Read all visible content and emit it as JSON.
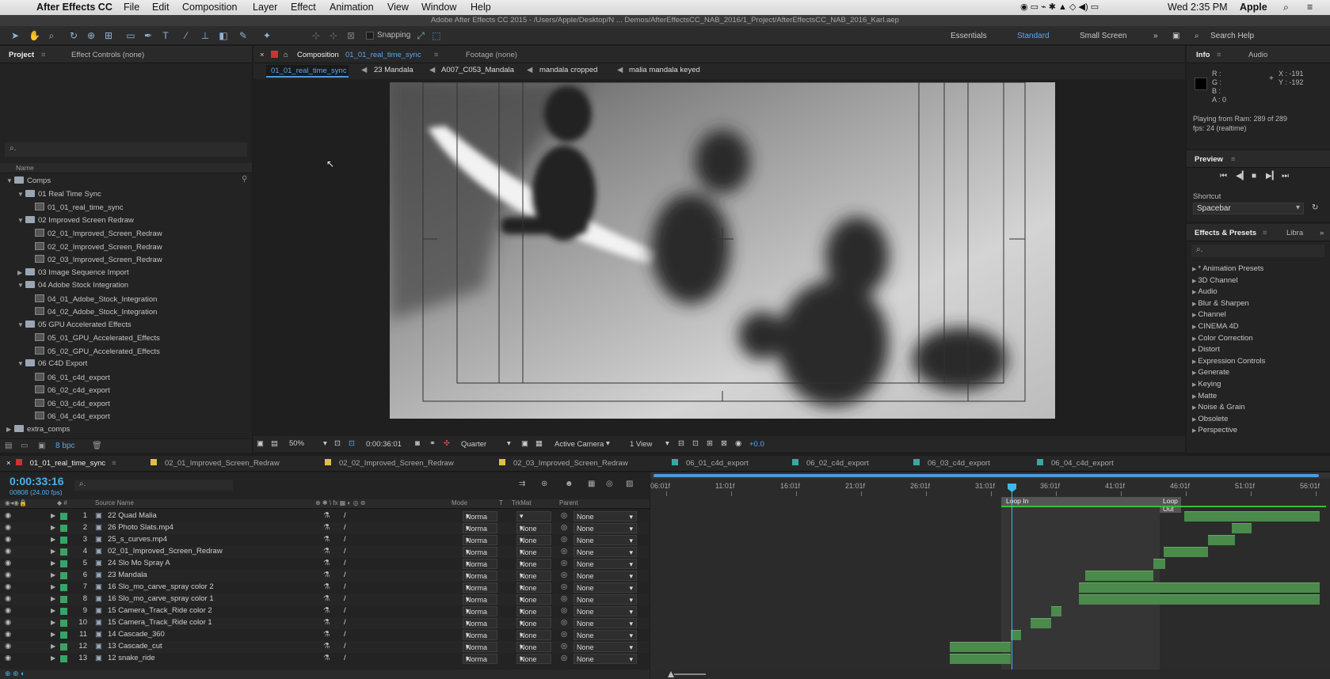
{
  "menubar": {
    "app": "After Effects CC",
    "menus": [
      "File",
      "Edit",
      "Composition",
      "Layer",
      "Effect",
      "Animation",
      "View",
      "Window",
      "Help"
    ],
    "clock": "Wed 2:35 PM",
    "user": "Apple"
  },
  "window_title": "Adobe After Effects CC 2015 - /Users/Apple/Desktop/N ... Demos/AfterEffectsCC_NAB_2016/1_Project/AfterEffectsCC_NAB_2016_Karl.aep",
  "toolbar": {
    "snapping": "Snapping",
    "workspaces": [
      "Essentials",
      "Standard",
      "Small Screen"
    ],
    "search_help": "Search Help"
  },
  "project": {
    "tab": "Project",
    "tab2": "Effect Controls (none)",
    "name_header": "Name",
    "bpc": "8 bpc",
    "tree": [
      {
        "level": 0,
        "type": "folder",
        "open": true,
        "label": "Comps"
      },
      {
        "level": 1,
        "type": "folder",
        "open": true,
        "label": "01 Real Time Sync"
      },
      {
        "level": 2,
        "type": "comp",
        "label": "01_01_real_time_sync"
      },
      {
        "level": 1,
        "type": "folder",
        "open": true,
        "label": "02 Improved Screen Redraw"
      },
      {
        "level": 2,
        "type": "comp",
        "label": "02_01_Improved_Screen_Redraw"
      },
      {
        "level": 2,
        "type": "comp",
        "label": "02_02_Improved_Screen_Redraw"
      },
      {
        "level": 2,
        "type": "comp",
        "label": "02_03_Improved_Screen_Redraw"
      },
      {
        "level": 1,
        "type": "folder",
        "open": false,
        "label": "03 Image Sequence Import"
      },
      {
        "level": 1,
        "type": "folder",
        "open": true,
        "label": "04 Adobe Stock Integration"
      },
      {
        "level": 2,
        "type": "comp",
        "label": "04_01_Adobe_Stock_Integration"
      },
      {
        "level": 2,
        "type": "comp",
        "label": "04_02_Adobe_Stock_Integration"
      },
      {
        "level": 1,
        "type": "folder",
        "open": true,
        "label": "05 GPU Accelerated Effects"
      },
      {
        "level": 2,
        "type": "comp",
        "label": "05_01_GPU_Accelerated_Effects"
      },
      {
        "level": 2,
        "type": "comp",
        "label": "05_02_GPU_Accelerated_Effects"
      },
      {
        "level": 1,
        "type": "folder",
        "open": true,
        "label": "06 C4D Export"
      },
      {
        "level": 2,
        "type": "comp",
        "label": "06_01_c4d_export"
      },
      {
        "level": 2,
        "type": "comp",
        "label": "06_02_c4d_export"
      },
      {
        "level": 2,
        "type": "comp",
        "label": "06_03_c4d_export"
      },
      {
        "level": 2,
        "type": "comp",
        "label": "06_04_c4d_export"
      },
      {
        "level": 0,
        "type": "folder",
        "open": false,
        "label": "extra_comps"
      }
    ]
  },
  "composition": {
    "tab_prefix": "Composition",
    "tab_name": "01_01_real_time_sync",
    "footage_tab": "Footage (none)",
    "breadcrumbs": [
      "01_01_real_time_sync",
      "23 Mandala",
      "A007_C053_Mandala",
      "mandala cropped",
      "malia mandala keyed"
    ],
    "zoom": "50%",
    "timecode": "0:00:36:01",
    "resolution": "Quarter",
    "camera": "Active Camera",
    "views": "1 View",
    "exposure": "+0.0"
  },
  "info": {
    "tab": "Info",
    "tab2": "Audio",
    "r": "R :",
    "g": "G :",
    "b": "B :",
    "a": "A : 0",
    "x": "X : -191",
    "y": "Y : -192",
    "playing": "Playing from Ram: 289 of 289",
    "fps": "fps: 24 (realtime)"
  },
  "preview": {
    "title": "Preview",
    "shortcut_label": "Shortcut",
    "shortcut_value": "Spacebar"
  },
  "effects": {
    "tab": "Effects & Presets",
    "tab2": "Libra",
    "items": [
      "* Animation Presets",
      "3D Channel",
      "Audio",
      "Blur & Sharpen",
      "Channel",
      "CINEMA 4D",
      "Color Correction",
      "Distort",
      "Expression Controls",
      "Generate",
      "Keying",
      "Matte",
      "Noise & Grain",
      "Obsolete",
      "Perspective"
    ]
  },
  "timeline": {
    "tabs": [
      "01_01_real_time_sync",
      "02_01_Improved_Screen_Redraw",
      "02_02_Improved_Screen_Redraw",
      "02_03_Improved_Screen_Redraw",
      "06_01_c4d_export",
      "06_02_c4d_export",
      "06_03_c4d_export",
      "06_04_c4d_export"
    ],
    "tab_colors": [
      "#e0c040",
      "#e0c040",
      "#e0c040",
      "#e0c040",
      "#3aa7a0",
      "#3aa7a0",
      "#3aa7a0",
      "#3aa7a0"
    ],
    "current_time": "0:00:33:16",
    "frame_info": "00808 (24.00 fps)",
    "col_headers": {
      "source": "Source Name",
      "mode": "Mode",
      "t": "T",
      "trkmat": "TrkMat",
      "parent": "Parent"
    },
    "ruler": [
      "06:01f",
      "11:01f",
      "16:01f",
      "21:01f",
      "26:01f",
      "31:01f",
      "36:01f",
      "41:01f",
      "46:01f",
      "51:01f",
      "56:01f"
    ],
    "loop_in": "Loop In",
    "loop_out": "Loop Out",
    "layers": [
      {
        "num": "1",
        "name": "22 Quad Malia",
        "mode": "Norma",
        "trkmat": "",
        "parent": "None",
        "bar_start": 0.786,
        "bar_end": 0.985
      },
      {
        "num": "2",
        "name": "26 Photo Slats.mp4",
        "mode": "Norma",
        "trkmat": "None",
        "parent": "None",
        "bar_start": 0.855,
        "bar_end": 0.885
      },
      {
        "num": "3",
        "name": "25_s_curves.mp4",
        "mode": "Norma",
        "trkmat": "None",
        "parent": "None",
        "bar_start": 0.82,
        "bar_end": 0.86
      },
      {
        "num": "4",
        "name": "02_01_Improved_Screen_Redraw",
        "mode": "Norma",
        "trkmat": "None",
        "parent": "None",
        "bar_start": 0.755,
        "bar_end": 0.82
      },
      {
        "num": "5",
        "name": "24 Slo Mo Spray A",
        "mode": "Norma",
        "trkmat": "None",
        "parent": "None",
        "bar_start": 0.74,
        "bar_end": 0.758
      },
      {
        "num": "6",
        "name": "23 Mandala",
        "mode": "Norma",
        "trkmat": "None",
        "parent": "None",
        "bar_start": 0.64,
        "bar_end": 0.74
      },
      {
        "num": "7",
        "name": "16 Slo_mo_carve_spray color 2",
        "mode": "Norma",
        "trkmat": "None",
        "parent": "None",
        "bar_start": 0.63,
        "bar_end": 0.985
      },
      {
        "num": "8",
        "name": "16 Slo_mo_carve_spray color 1",
        "mode": "Norma",
        "trkmat": "None",
        "parent": "None",
        "bar_start": 0.63,
        "bar_end": 0.985
      },
      {
        "num": "9",
        "name": "15 Camera_Track_Ride color 2",
        "mode": "Norma",
        "trkmat": "None",
        "parent": "None",
        "bar_start": 0.59,
        "bar_end": 0.605
      },
      {
        "num": "10",
        "name": "15 Camera_Track_Ride color 1",
        "mode": "Norma",
        "trkmat": "None",
        "parent": "None",
        "bar_start": 0.56,
        "bar_end": 0.59
      },
      {
        "num": "11",
        "name": "14 Cascade_360",
        "mode": "Norma",
        "trkmat": "None",
        "parent": "None",
        "bar_start": 0.53,
        "bar_end": 0.545
      },
      {
        "num": "12",
        "name": "13 Cascade_cut",
        "mode": "Norma",
        "trkmat": "None",
        "parent": "None",
        "bar_start": 0.44,
        "bar_end": 0.53
      },
      {
        "num": "13",
        "name": "12 snake_ride",
        "mode": "Norma",
        "trkmat": "None",
        "parent": "None",
        "bar_start": 0.44,
        "bar_end": 0.53
      }
    ]
  }
}
